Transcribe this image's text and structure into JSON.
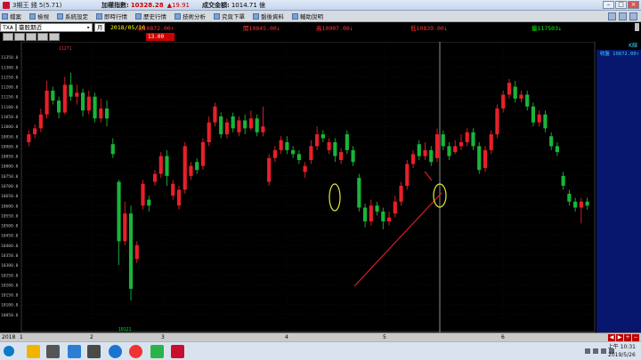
{
  "window": {
    "title": "3期王 錢 5(5.71)",
    "index_label": "加權指數:",
    "index_value": "10328.28",
    "index_change": "▲19.91",
    "amount_label": "成交金額:",
    "amount_value": "1014.71 億",
    "min_icon": "minimize-icon",
    "max_icon": "maximize-icon",
    "close_icon": "close-icon"
  },
  "menu": {
    "items": [
      "檔案",
      "檢視",
      "系統設定",
      "即時行情",
      "歷史行情",
      "技術分析",
      "究竟下單",
      "盤後資料",
      "輔助說明"
    ]
  },
  "quote": {
    "symbol": "TXA",
    "name": "臺股期近",
    "period": "月",
    "date": "2018/05/16",
    "close": "收10872.00↑",
    "open": "開10845.00↓",
    "high": "高10907.00↓",
    "low": "低10839.00↓",
    "volume": "量117503↓",
    "secondary_value": "13.00",
    "panel_head": "K線",
    "panel_quote": "收盤 10872.00↑"
  },
  "timebar": {
    "year": "2018",
    "months": [
      "1",
      "2",
      "3",
      "4",
      "5",
      "6"
    ],
    "low_marker": "10121",
    "high_marker": "11271"
  },
  "taskbar": {
    "time": "上午 10:31",
    "date": "2019/5/26"
  },
  "colors": {
    "up": "#e8202a",
    "down": "#19b53a",
    "trendline": "#e8202a",
    "highlight": "#e6e63a",
    "panel": "#08176e"
  },
  "chart_data": {
    "type": "candlestick",
    "ylim": [
      10000,
      11400
    ],
    "yticks": [
      11350,
      11300,
      11250,
      11200,
      11150,
      11100,
      11050,
      11000,
      10950,
      10900,
      10850,
      10800,
      10750,
      10700,
      10650,
      10600,
      10550,
      10500,
      10450,
      10400,
      10350,
      10300,
      10250,
      10200,
      10150,
      10100,
      10050
    ],
    "candles": [
      {
        "o": 10920,
        "c": 10960,
        "h": 10980,
        "l": 10900
      },
      {
        "o": 10960,
        "c": 10990,
        "h": 11010,
        "l": 10940
      },
      {
        "o": 10990,
        "c": 11060,
        "h": 11090,
        "l": 10970
      },
      {
        "o": 11060,
        "c": 11180,
        "h": 11230,
        "l": 11040
      },
      {
        "o": 11180,
        "c": 11130,
        "h": 11200,
        "l": 11110
      },
      {
        "o": 11130,
        "c": 11070,
        "h": 11150,
        "l": 11040
      },
      {
        "o": 11070,
        "c": 11210,
        "h": 11250,
        "l": 11060
      },
      {
        "o": 11210,
        "c": 11150,
        "h": 11271,
        "l": 11130
      },
      {
        "o": 11150,
        "c": 11170,
        "h": 11210,
        "l": 11110
      },
      {
        "o": 11170,
        "c": 11080,
        "h": 11190,
        "l": 11050
      },
      {
        "o": 11080,
        "c": 11150,
        "h": 11180,
        "l": 11060
      },
      {
        "o": 11150,
        "c": 11040,
        "h": 11170,
        "l": 11020
      },
      {
        "o": 11040,
        "c": 11090,
        "h": 11140,
        "l": 11020
      },
      {
        "o": 11090,
        "c": 11040,
        "h": 11130,
        "l": 11000
      },
      {
        "o": 10910,
        "c": 10860,
        "h": 10940,
        "l": 10840
      },
      {
        "o": 10720,
        "c": 10420,
        "h": 10730,
        "l": 10300
      },
      {
        "o": 10420,
        "c": 10560,
        "h": 10620,
        "l": 10400
      },
      {
        "o": 10560,
        "c": 10180,
        "h": 10600,
        "l": 10121
      },
      {
        "o": 10330,
        "c": 10400,
        "h": 10420,
        "l": 10310
      },
      {
        "o": 10600,
        "c": 10710,
        "h": 10730,
        "l": 10580
      },
      {
        "o": 10630,
        "c": 10600,
        "h": 10650,
        "l": 10570
      },
      {
        "o": 10720,
        "c": 10760,
        "h": 10780,
        "l": 10700
      },
      {
        "o": 10760,
        "c": 10850,
        "h": 10870,
        "l": 10740
      },
      {
        "o": 10850,
        "c": 10750,
        "h": 10880,
        "l": 10700
      },
      {
        "o": 10650,
        "c": 10710,
        "h": 10730,
        "l": 10630
      },
      {
        "o": 10600,
        "c": 10680,
        "h": 10700,
        "l": 10580
      },
      {
        "o": 10680,
        "c": 10900,
        "h": 10920,
        "l": 10660
      },
      {
        "o": 10750,
        "c": 10800,
        "h": 10820,
        "l": 10730
      },
      {
        "o": 10820,
        "c": 10780,
        "h": 10840,
        "l": 10760
      },
      {
        "o": 10800,
        "c": 10920,
        "h": 10940,
        "l": 10780
      },
      {
        "o": 10920,
        "c": 11020,
        "h": 11050,
        "l": 10900
      },
      {
        "o": 11020,
        "c": 11100,
        "h": 11120,
        "l": 11000
      },
      {
        "o": 11050,
        "c": 10960,
        "h": 11070,
        "l": 10940
      },
      {
        "o": 10960,
        "c": 11020,
        "h": 11040,
        "l": 10940
      },
      {
        "o": 11050,
        "c": 10990,
        "h": 11070,
        "l": 10970
      },
      {
        "o": 10970,
        "c": 11030,
        "h": 11050,
        "l": 10950
      },
      {
        "o": 11030,
        "c": 10990,
        "h": 11060,
        "l": 10960
      },
      {
        "o": 10990,
        "c": 11040,
        "h": 11080,
        "l": 10980
      },
      {
        "o": 11040,
        "c": 10970,
        "h": 11060,
        "l": 10950
      },
      {
        "o": 10970,
        "c": 11000,
        "h": 11100,
        "l": 10950
      },
      {
        "o": 10720,
        "c": 10840,
        "h": 10860,
        "l": 10700
      },
      {
        "o": 10840,
        "c": 10880,
        "h": 10900,
        "l": 10820
      },
      {
        "o": 10880,
        "c": 10930,
        "h": 10950,
        "l": 10860
      },
      {
        "o": 10920,
        "c": 10880,
        "h": 10950,
        "l": 10860
      },
      {
        "o": 10880,
        "c": 10860,
        "h": 10900,
        "l": 10840
      },
      {
        "o": 10860,
        "c": 10830,
        "h": 10880,
        "l": 10810
      },
      {
        "o": 10770,
        "c": 10800,
        "h": 10820,
        "l": 10740
      },
      {
        "o": 10830,
        "c": 10900,
        "h": 10930,
        "l": 10810
      },
      {
        "o": 10900,
        "c": 10960,
        "h": 11000,
        "l": 10880
      },
      {
        "o": 10960,
        "c": 10940,
        "h": 10980,
        "l": 10920
      },
      {
        "o": 10880,
        "c": 10920,
        "h": 10940,
        "l": 10860
      },
      {
        "o": 10920,
        "c": 10850,
        "h": 10940,
        "l": 10820
      },
      {
        "o": 10830,
        "c": 10870,
        "h": 10890,
        "l": 10810
      },
      {
        "o": 10960,
        "c": 10880,
        "h": 10980,
        "l": 10860
      },
      {
        "o": 10880,
        "c": 10820,
        "h": 10900,
        "l": 10800
      },
      {
        "o": 10740,
        "c": 10590,
        "h": 10760,
        "l": 10570
      },
      {
        "o": 10590,
        "c": 10520,
        "h": 10610,
        "l": 10490
      },
      {
        "o": 10520,
        "c": 10600,
        "h": 10630,
        "l": 10500
      },
      {
        "o": 10600,
        "c": 10570,
        "h": 10620,
        "l": 10550
      },
      {
        "o": 10570,
        "c": 10520,
        "h": 10590,
        "l": 10480
      },
      {
        "o": 10520,
        "c": 10540,
        "h": 10570,
        "l": 10500
      },
      {
        "o": 10560,
        "c": 10620,
        "h": 10650,
        "l": 10540
      },
      {
        "o": 10620,
        "c": 10700,
        "h": 10720,
        "l": 10600
      },
      {
        "o": 10700,
        "c": 10810,
        "h": 10830,
        "l": 10680
      },
      {
        "o": 10810,
        "c": 10860,
        "h": 10880,
        "l": 10790
      },
      {
        "o": 10910,
        "c": 10850,
        "h": 10930,
        "l": 10830
      },
      {
        "o": 10850,
        "c": 10880,
        "h": 10920,
        "l": 10830
      },
      {
        "o": 10880,
        "c": 10820,
        "h": 10900,
        "l": 10800
      },
      {
        "o": 10840,
        "c": 10960,
        "h": 10990,
        "l": 10820
      },
      {
        "o": 10960,
        "c": 10900,
        "h": 10980,
        "l": 10880
      },
      {
        "o": 10900,
        "c": 10850,
        "h": 10920,
        "l": 10830
      },
      {
        "o": 10870,
        "c": 10900,
        "h": 10930,
        "l": 10860
      },
      {
        "o": 10900,
        "c": 10920,
        "h": 10960,
        "l": 10880
      },
      {
        "o": 10920,
        "c": 10970,
        "h": 10990,
        "l": 10900
      },
      {
        "o": 10970,
        "c": 10900,
        "h": 10990,
        "l": 10880
      },
      {
        "o": 10900,
        "c": 10780,
        "h": 10920,
        "l": 10760
      },
      {
        "o": 10790,
        "c": 10880,
        "h": 10900,
        "l": 10770
      },
      {
        "o": 10880,
        "c": 10960,
        "h": 10980,
        "l": 10860
      },
      {
        "o": 10960,
        "c": 11090,
        "h": 11110,
        "l": 10940
      },
      {
        "o": 11090,
        "c": 11160,
        "h": 11180,
        "l": 11070
      },
      {
        "o": 11160,
        "c": 11220,
        "h": 11240,
        "l": 11140
      },
      {
        "o": 11200,
        "c": 11140,
        "h": 11230,
        "l": 11120
      },
      {
        "o": 11140,
        "c": 11160,
        "h": 11180,
        "l": 11120
      },
      {
        "o": 11160,
        "c": 11100,
        "h": 11180,
        "l": 11080
      },
      {
        "o": 11100,
        "c": 11020,
        "h": 11120,
        "l": 11000
      },
      {
        "o": 11020,
        "c": 11060,
        "h": 11080,
        "l": 11000
      },
      {
        "o": 11060,
        "c": 10990,
        "h": 11080,
        "l": 10970
      },
      {
        "o": 10950,
        "c": 10900,
        "h": 10970,
        "l": 10880
      },
      {
        "o": 10900,
        "c": 10870,
        "h": 10920,
        "l": 10850
      },
      {
        "o": 10750,
        "c": 10700,
        "h": 10770,
        "l": 10680
      },
      {
        "o": 10660,
        "c": 10620,
        "h": 10680,
        "l": 10600
      },
      {
        "o": 10620,
        "c": 10590,
        "h": 10640,
        "l": 10570
      },
      {
        "o": 10590,
        "c": 10620,
        "h": 10640,
        "l": 10510
      },
      {
        "o": 10620,
        "c": 10600,
        "h": 10640,
        "l": 10580
      }
    ]
  }
}
